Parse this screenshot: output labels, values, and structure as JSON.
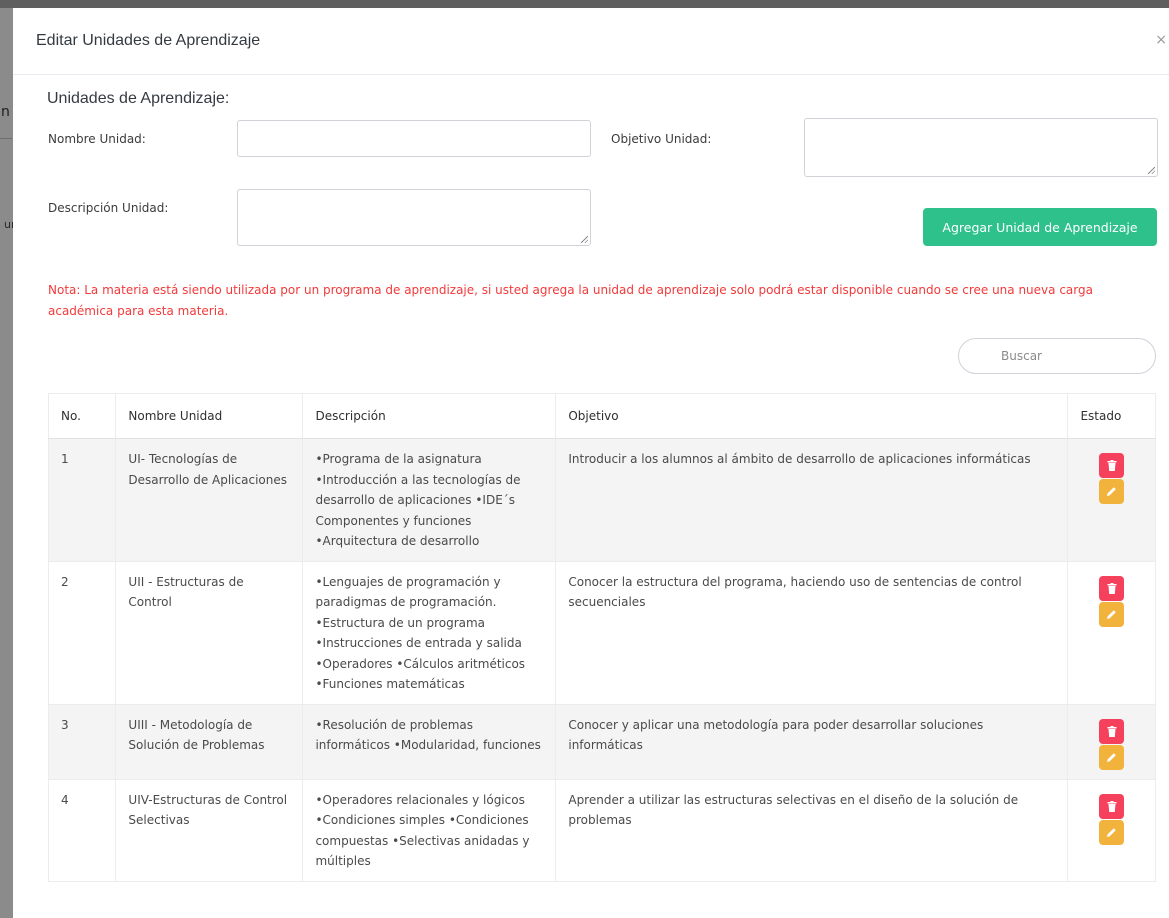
{
  "background": {
    "fragment_1": "n",
    "fragment_2": "un"
  },
  "modal": {
    "title": "Editar Unidades de Aprendizaje",
    "close_label": "×"
  },
  "form": {
    "section_title": "Unidades de Aprendizaje:",
    "name_label": "Nombre Unidad:",
    "name_value": "",
    "objective_label": "Objetivo Unidad:",
    "objective_value": "",
    "description_label": "Descripción Unidad:",
    "description_value": "",
    "add_button_label": "Agregar Unidad de Aprendizaje"
  },
  "note": "Nota: La materia está siendo utilizada por un programa de aprendizaje, si usted agrega la unidad de aprendizaje solo podrá estar disponible cuando se cree una nueva carga académica para esta materia.",
  "search": {
    "placeholder": "Buscar",
    "value": ""
  },
  "table": {
    "headers": {
      "no": "No.",
      "name": "Nombre Unidad",
      "description": "Descripción",
      "objective": "Objetivo",
      "status": "Estado"
    },
    "rows": [
      {
        "no": "1",
        "name": "UI- Tecnologías de Desarrollo de Aplicaciones",
        "description": "•Programa de la asignatura •Introducción a las tecnologías de desarrollo de aplicaciones •IDE´s Componentes y funciones •Arquitectura de desarrollo",
        "objective": "Introducir a los alumnos al ámbito de desarrollo de aplicaciones informáticas"
      },
      {
        "no": "2",
        "name": "UII - Estructuras de Control",
        "description": "•Lenguajes de programación y paradigmas de programación. •Estructura de un programa •Instrucciones de entrada y salida •Operadores •Cálculos aritméticos •Funciones matemáticas",
        "objective": "Conocer la estructura del programa, haciendo uso de sentencias de control secuenciales"
      },
      {
        "no": "3",
        "name": "UIII - Metodología de Solución de Problemas",
        "description": "•Resolución de problemas informáticos •Modularidad, funciones",
        "objective": "Conocer y aplicar una metodología para poder desarrollar soluciones informáticas"
      },
      {
        "no": "4",
        "name": "UIV-Estructuras de Control Selectivas",
        "description": "•Operadores relacionales y lógicos •Condiciones simples •Condiciones compuestas •Selectivas anidadas y múltiples",
        "objective": "Aprender a utilizar las estructuras selectivas en el diseño de la solución de problemas"
      }
    ]
  },
  "icons": {
    "delete": "trash-icon",
    "edit": "pencil-icon",
    "delete_color": "#f5415c",
    "edit_color": "#f2b33d"
  },
  "colors": {
    "accent_green": "#2fc18c",
    "note_red": "#f23a3a"
  }
}
